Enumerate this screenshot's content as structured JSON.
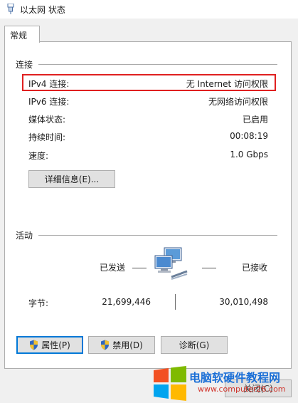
{
  "window": {
    "title": "以太网 状态",
    "icon": "network-adapter-icon"
  },
  "tabs": [
    {
      "label": "常规",
      "selected": true
    }
  ],
  "connection": {
    "section_title": "连接",
    "rows": [
      {
        "label": "IPv4 连接:",
        "value": "无 Internet 访问权限"
      },
      {
        "label": "IPv6 连接:",
        "value": "无网络访问权限"
      },
      {
        "label": "媒体状态:",
        "value": "已启用"
      },
      {
        "label": "持续时间:",
        "value": "00:08:19"
      },
      {
        "label": "速度:",
        "value": "1.0 Gbps"
      }
    ],
    "details_button": "详细信息(E)..."
  },
  "activity": {
    "section_title": "活动",
    "sent_label": "已发送",
    "received_label": "已接收",
    "bytes_label": "字节:",
    "bytes_sent": "21,699,446",
    "bytes_received": "30,010,498"
  },
  "buttons": {
    "properties": "属性(P)",
    "disable": "禁用(D)",
    "diagnose": "诊断(G)",
    "close": "关闭(C)"
  },
  "watermark": {
    "title": "电脑软硬件教程网",
    "url": "www.computer26.com"
  },
  "colors": {
    "highlight_border": "#e02020",
    "default_button_border": "#0078d7",
    "watermark_title": "#1b6fd6",
    "watermark_url": "#d0352d"
  }
}
